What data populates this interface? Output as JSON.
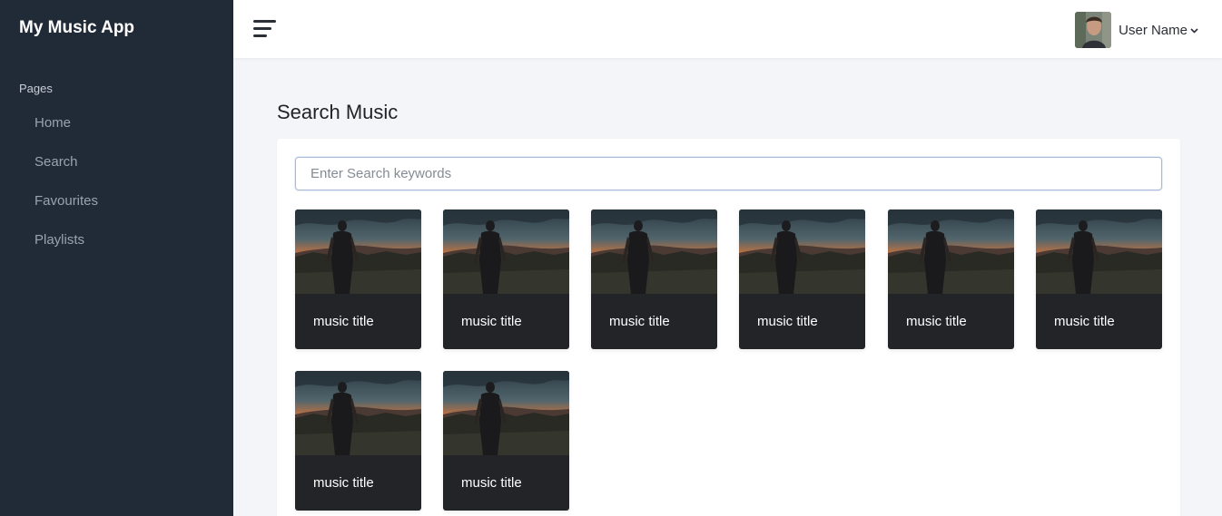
{
  "app": {
    "title": "My Music App"
  },
  "sidebar": {
    "section_label": "Pages",
    "items": [
      {
        "label": "Home"
      },
      {
        "label": "Search"
      },
      {
        "label": "Favourites"
      },
      {
        "label": "Playlists"
      }
    ]
  },
  "topbar": {
    "menu_icon": "hamburger-menu-icon",
    "user_name": "User Name",
    "dropdown_icon": "chevron-down-icon"
  },
  "main": {
    "title": "Search Music",
    "search": {
      "placeholder": "Enter Search keywords",
      "value": ""
    },
    "results": [
      {
        "title": "music title"
      },
      {
        "title": "music title"
      },
      {
        "title": "music title"
      },
      {
        "title": "music title"
      },
      {
        "title": "music title"
      },
      {
        "title": "music title"
      },
      {
        "title": "music title"
      },
      {
        "title": "music title"
      }
    ]
  },
  "colors": {
    "sidebar_bg": "#212a37",
    "card_bg": "#222428",
    "page_bg": "#f4f5f8"
  }
}
